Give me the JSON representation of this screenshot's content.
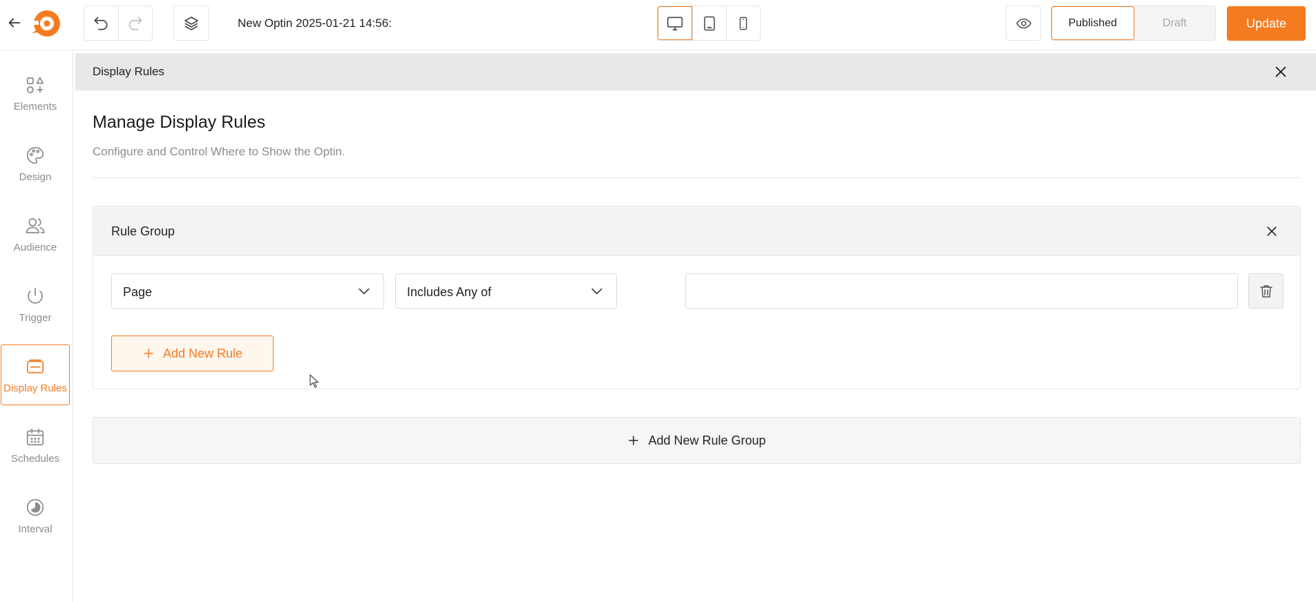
{
  "topbar": {
    "title": "New Optin 2025-01-21 14:56:",
    "status_options": [
      "Published",
      "Draft"
    ],
    "active_status": "Published",
    "update_label": "Update",
    "active_device": "desktop"
  },
  "sidebar": {
    "items": [
      {
        "label": "Elements",
        "icon": "elements-icon"
      },
      {
        "label": "Design",
        "icon": "palette-icon"
      },
      {
        "label": "Audience",
        "icon": "users-icon"
      },
      {
        "label": "Trigger",
        "icon": "power-icon"
      },
      {
        "label": "Display Rules",
        "icon": "display-rules-icon",
        "active": true
      },
      {
        "label": "Schedules",
        "icon": "calendar-icon"
      },
      {
        "label": "Interval",
        "icon": "interval-icon"
      }
    ]
  },
  "panel": {
    "header_title": "Display Rules",
    "title": "Manage Display Rules",
    "subtitle": "Configure and Control Where to Show the Optin."
  },
  "rule_group": {
    "title": "Rule Group",
    "rules": [
      {
        "field": "Page",
        "operator": "Includes Any of",
        "value": ""
      }
    ],
    "add_rule_label": "Add New Rule"
  },
  "add_group_label": "Add New Rule Group",
  "colors": {
    "accent": "#f47b20",
    "muted_text": "#8c8c8c",
    "header_bg": "#e8e8e8"
  }
}
